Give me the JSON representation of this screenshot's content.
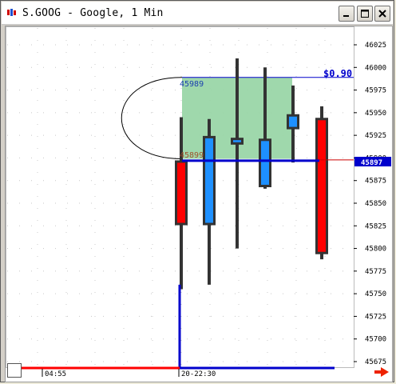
{
  "window": {
    "title": "S.GOOG - Google, 1 Min"
  },
  "colors": {
    "up_candle": "#1e90ff",
    "down_candle": "#ff0000",
    "wick": "#333333",
    "selection_fill": "#9ad6a8",
    "blue_line": "#0000cc",
    "red_axis": "#ff0000",
    "price_tag_bg": "#0000cc"
  },
  "y_axis": {
    "ticks": [
      "46025",
      "46000",
      "45975",
      "45950",
      "45925",
      "45900",
      "45875",
      "45850",
      "45825",
      "45800",
      "45775",
      "45750",
      "45725",
      "45700",
      "45675"
    ]
  },
  "x_axis": {
    "labels": [
      "04:55",
      "20-22:30"
    ]
  },
  "annotations": {
    "change_label": "$0.90",
    "top_value": "45989",
    "bottom_value": "45899",
    "current_price": "45897"
  },
  "chart_data": {
    "type": "candlestick",
    "candles": [
      {
        "open": 45896,
        "close": 45827,
        "high": 45945,
        "low": 45755,
        "color": "down"
      },
      {
        "open": 45827,
        "close": 45923,
        "high": 45943,
        "low": 45760,
        "color": "up"
      },
      {
        "open": 45921,
        "close": 45916,
        "high": 46010,
        "low": 45800,
        "color": "up"
      },
      {
        "open": 45869,
        "close": 45920,
        "high": 46000,
        "low": 45866,
        "color": "up"
      },
      {
        "open": 45933,
        "close": 45947,
        "high": 45980,
        "low": 45895,
        "color": "up"
      },
      {
        "open": 45943,
        "close": 45795,
        "high": 45957,
        "low": 45788,
        "color": "down"
      }
    ],
    "selection": {
      "high": 45989,
      "low": 45899
    },
    "current_price": 45897,
    "ylim": [
      45664,
      46037
    ]
  }
}
